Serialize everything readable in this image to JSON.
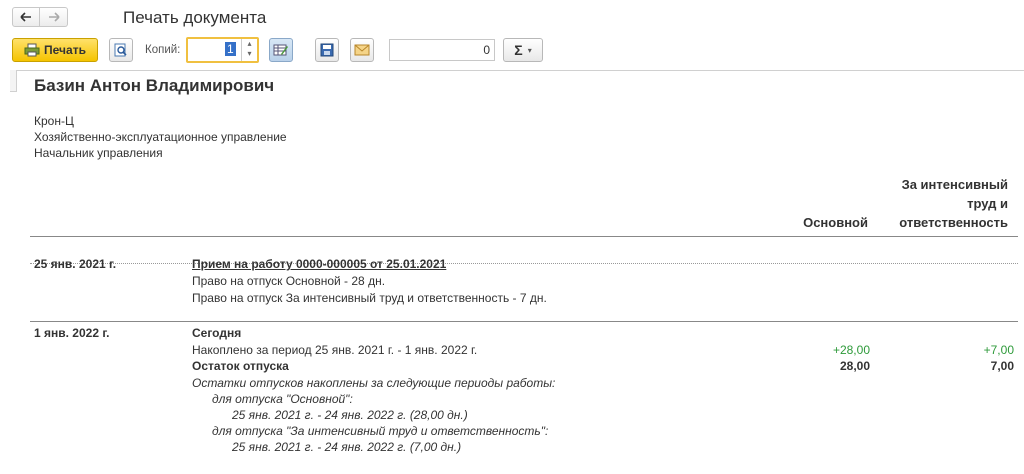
{
  "header": {
    "title": "Печать документа"
  },
  "toolbar": {
    "print_label": "Печать",
    "copies_label": "Копий:",
    "copies_value": "1",
    "sum_value": "0",
    "sum_symbol": "Σ",
    "dropdown_symbol": "▾"
  },
  "icons": {
    "back": "arrow-left-icon",
    "forward": "arrow-right-icon",
    "print": "printer-icon",
    "preview": "magnifier-icon",
    "edit": "edit-table-icon",
    "save": "floppy-icon",
    "mail": "envelope-icon",
    "sum": "sigma-icon"
  },
  "colors": {
    "accent_print": "#f5c400",
    "focus_border": "#f0c040",
    "positive": "#2e9a3a"
  },
  "document": {
    "employee_name": "Базин Антон Владимирович",
    "organization": "Крон-Ц",
    "department": "Хозяйственно-эксплуатационное управление",
    "position": "Начальник управления",
    "columns": {
      "main": "Основной",
      "intensive_line1": "За интенсивный",
      "intensive_line2": "труд и",
      "intensive_line3": "ответственность"
    },
    "entry1": {
      "date": "25 янв. 2021 г.",
      "title": "Прием на работу 0000-000005 от 25.01.2021",
      "line1": "Право на отпуск Основной - 28 дн.",
      "line2": "Право на отпуск За интенсивный труд и ответственность - 7 дн."
    },
    "entry2": {
      "date": "1 янв. 2022 г.",
      "title": "Сегодня",
      "accrued_label": "Накоплено за период 25 янв. 2021 г. - 1 янв. 2022 г.",
      "accrued_main": "+28,00",
      "accrued_intensive": "+7,00",
      "balance_label": "Остаток отпуска",
      "balance_main": "28,00",
      "balance_intensive": "7,00",
      "note1": "Остатки отпусков накоплены за следующие периоды работы:",
      "note2": "для отпуска \"Основной\":",
      "note3": "25 янв. 2021 г. - 24 янв. 2022 г. (28,00 дн.)",
      "note4": "для отпуска \"За интенсивный труд и ответственность\":",
      "note5": "25 янв. 2021 г. - 24 янв. 2022 г. (7,00 дн.)"
    }
  }
}
